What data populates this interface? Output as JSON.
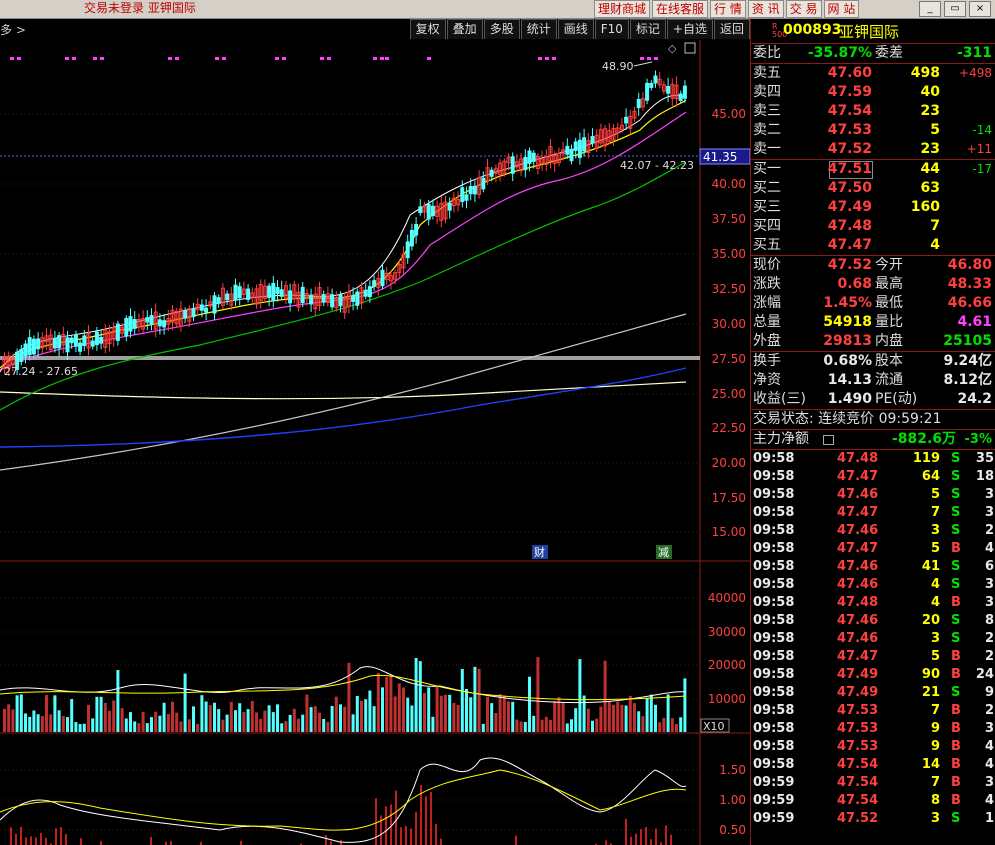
{
  "titlebar": {
    "status_text": "交易未登录  亚钾国际"
  },
  "topnav": [
    "理财商城",
    "在线客服",
    "行  情",
    "资  讯",
    "交  易",
    "网  站"
  ],
  "window_buttons": [
    "_",
    "▭",
    "×"
  ],
  "toolbar": {
    "crumb": "多 >",
    "buttons": [
      "复权",
      "叠加",
      "多股",
      "统计",
      "画线",
      "F10",
      "标记",
      "+自选",
      "返回"
    ]
  },
  "chart": {
    "price_axis": [
      "45.00",
      "42.50",
      "40.00",
      "37.50",
      "35.00",
      "32.50",
      "30.00",
      "27.50",
      "25.00",
      "22.50",
      "20.00",
      "17.50",
      "15.00"
    ],
    "current_price_tag": "41.35",
    "annotations": {
      "high": "48.90",
      "low": "27.24 - 27.65",
      "mid": "42.07 - 42.23"
    },
    "event_tags": [
      "财",
      "减"
    ],
    "volume_axis": [
      "40000",
      "30000",
      "20000",
      "10000"
    ],
    "volume_unit": "X10",
    "indicator_axis": [
      "1.50",
      "1.00",
      "0.50"
    ],
    "colors": {
      "up": "#ff3c3c",
      "down": "#54ffff",
      "ma5": "#ffffff",
      "ma10": "#ffff00",
      "ma20": "#ff40ff",
      "ma60": "#00c000",
      "ma120": "#c0c0c0",
      "ma250": "#ffffcc",
      "blue": "#2040ff"
    }
  },
  "quote": {
    "r_label": "R",
    "r_sub": "500",
    "code": "000893",
    "name": "亚钾国际",
    "webi_label": "委比",
    "webi_value": "-35.87%",
    "weicha_label": "委差",
    "weicha_value": "-311",
    "sell": [
      {
        "label": "卖五",
        "price": "47.60",
        "vol": "498",
        "chg": "+498"
      },
      {
        "label": "卖四",
        "price": "47.59",
        "vol": "40",
        "chg": ""
      },
      {
        "label": "卖三",
        "price": "47.54",
        "vol": "23",
        "chg": ""
      },
      {
        "label": "卖二",
        "price": "47.53",
        "vol": "5",
        "chg": "-14"
      },
      {
        "label": "卖一",
        "price": "47.52",
        "vol": "23",
        "chg": "+11"
      }
    ],
    "buy": [
      {
        "label": "买一",
        "price": "47.51",
        "vol": "44",
        "chg": "-17"
      },
      {
        "label": "买二",
        "price": "47.50",
        "vol": "63",
        "chg": ""
      },
      {
        "label": "买三",
        "price": "47.49",
        "vol": "160",
        "chg": ""
      },
      {
        "label": "买四",
        "price": "47.48",
        "vol": "7",
        "chg": ""
      },
      {
        "label": "买五",
        "price": "47.47",
        "vol": "4",
        "chg": ""
      }
    ],
    "stats": [
      {
        "l1": "现价",
        "v1": "47.52",
        "c1": "red",
        "l2": "今开",
        "v2": "46.80",
        "c2": "red"
      },
      {
        "l1": "涨跌",
        "v1": "0.68",
        "c1": "red",
        "l2": "最高",
        "v2": "48.33",
        "c2": "red"
      },
      {
        "l1": "涨幅",
        "v1": "1.45%",
        "c1": "red",
        "l2": "最低",
        "v2": "46.66",
        "c2": "red"
      },
      {
        "l1": "总量",
        "v1": "54918",
        "c1": "yellow",
        "l2": "量比",
        "v2": "4.61",
        "c2": "mag"
      },
      {
        "l1": "外盘",
        "v1": "29813",
        "c1": "red",
        "l2": "内盘",
        "v2": "25105",
        "c2": "green"
      }
    ],
    "stats2": [
      {
        "l1": "换手",
        "v1": "0.68%",
        "l2": "股本",
        "v2": "9.24亿"
      },
      {
        "l1": "净资",
        "v1": "14.13",
        "l2": "流通",
        "v2": "8.12亿"
      },
      {
        "l1": "收益(三)",
        "v1": "1.490",
        "l2": "PE(动)",
        "v2": "24.2"
      }
    ],
    "trade_status": "交易状态: 连续竞价 09:59:21",
    "main_flow_label": "主力净额",
    "main_flow_value": "-882.6万",
    "main_flow_pct": "-3%"
  },
  "ticks": [
    {
      "t": "09:58",
      "p": "47.48",
      "v": "119",
      "bs": "S",
      "n": "35"
    },
    {
      "t": "09:58",
      "p": "47.47",
      "v": "64",
      "bs": "S",
      "n": "18"
    },
    {
      "t": "09:58",
      "p": "47.46",
      "v": "5",
      "bs": "S",
      "n": "3"
    },
    {
      "t": "09:58",
      "p": "47.47",
      "v": "7",
      "bs": "S",
      "n": "3"
    },
    {
      "t": "09:58",
      "p": "47.46",
      "v": "3",
      "bs": "S",
      "n": "2"
    },
    {
      "t": "09:58",
      "p": "47.47",
      "v": "5",
      "bs": "B",
      "n": "4"
    },
    {
      "t": "09:58",
      "p": "47.46",
      "v": "41",
      "bs": "S",
      "n": "6"
    },
    {
      "t": "09:58",
      "p": "47.46",
      "v": "4",
      "bs": "S",
      "n": "3"
    },
    {
      "t": "09:58",
      "p": "47.48",
      "v": "4",
      "bs": "B",
      "n": "3"
    },
    {
      "t": "09:58",
      "p": "47.46",
      "v": "20",
      "bs": "S",
      "n": "8"
    },
    {
      "t": "09:58",
      "p": "47.46",
      "v": "3",
      "bs": "S",
      "n": "2"
    },
    {
      "t": "09:58",
      "p": "47.47",
      "v": "5",
      "bs": "B",
      "n": "2"
    },
    {
      "t": "09:58",
      "p": "47.49",
      "v": "90",
      "bs": "B",
      "n": "24"
    },
    {
      "t": "09:58",
      "p": "47.49",
      "v": "21",
      "bs": "S",
      "n": "9"
    },
    {
      "t": "09:58",
      "p": "47.53",
      "v": "7",
      "bs": "B",
      "n": "2"
    },
    {
      "t": "09:58",
      "p": "47.53",
      "v": "9",
      "bs": "B",
      "n": "3"
    },
    {
      "t": "09:58",
      "p": "47.53",
      "v": "9",
      "bs": "B",
      "n": "4"
    },
    {
      "t": "09:58",
      "p": "47.54",
      "v": "14",
      "bs": "B",
      "n": "4"
    },
    {
      "t": "09:59",
      "p": "47.54",
      "v": "7",
      "bs": "B",
      "n": "3"
    },
    {
      "t": "09:59",
      "p": "47.54",
      "v": "8",
      "bs": "B",
      "n": "4"
    },
    {
      "t": "09:59",
      "p": "47.52",
      "v": "3",
      "bs": "S",
      "n": "1"
    }
  ]
}
